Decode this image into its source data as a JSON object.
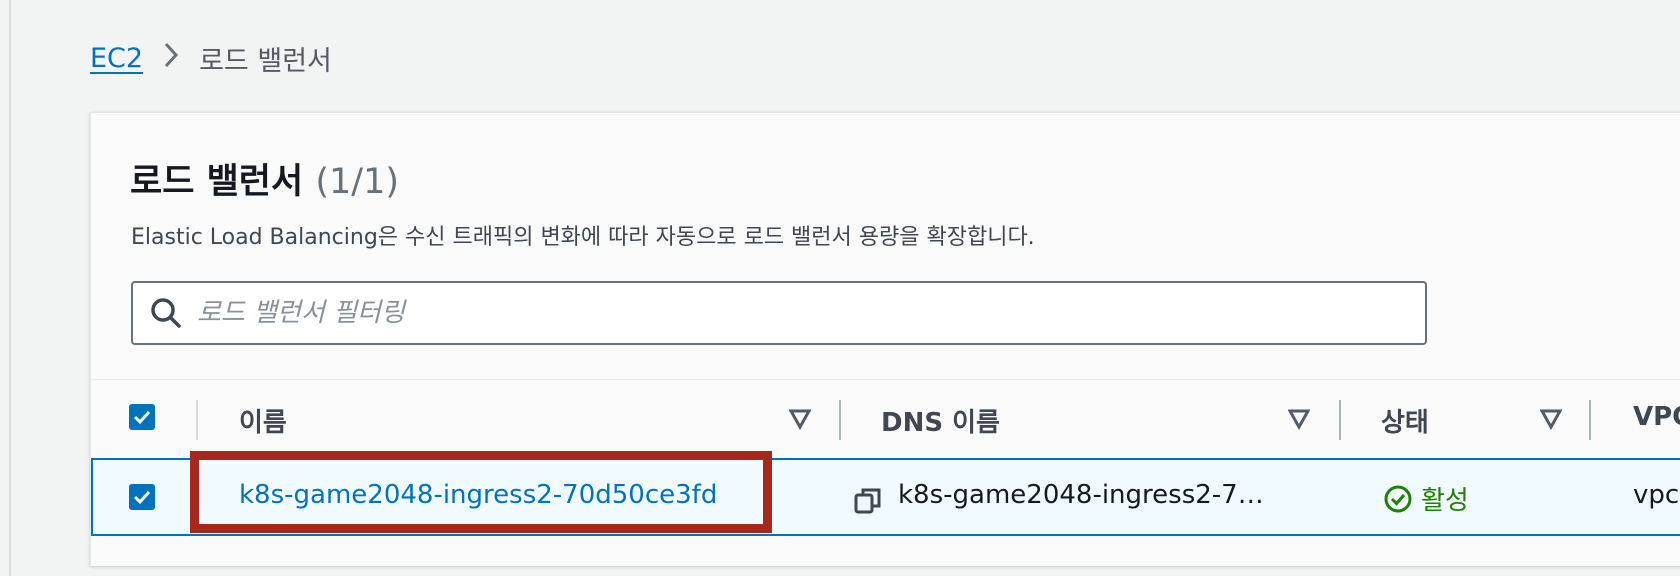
{
  "breadcrumb": {
    "root": "EC2",
    "current": "로드 밸런서"
  },
  "panel": {
    "title": "로드 밸런서",
    "count": "(1/1)",
    "description": "Elastic Load Balancing은 수신 트래픽의 변화에 따라 자동으로 로드 밸런서 용량을 확장합니다."
  },
  "search": {
    "placeholder": "로드 밸런서 필터링",
    "value": ""
  },
  "table": {
    "columns": [
      {
        "label": "이름"
      },
      {
        "label": "DNS 이름"
      },
      {
        "label": "상태"
      },
      {
        "label": "VPC"
      }
    ],
    "rows": [
      {
        "selected": true,
        "name": "k8s-game2048-ingress2-70d50ce3fd",
        "dns": "k8s-game2048-ingress2-7…",
        "status": "활성",
        "vpc": "vpc-"
      }
    ]
  },
  "colors": {
    "accent": "#0073bb",
    "status_active": "#1d8102",
    "highlight": "#a6281c"
  }
}
